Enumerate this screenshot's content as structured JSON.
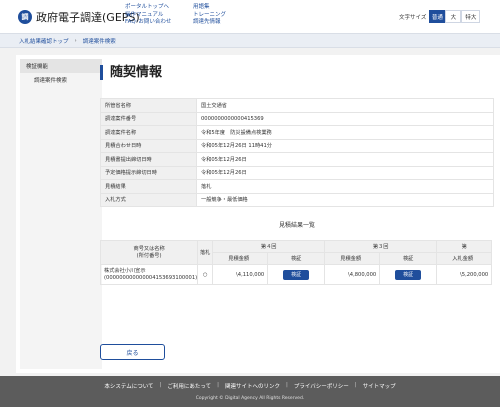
{
  "header": {
    "logo_mark": "調",
    "title": "政府電子調達(GEPS)",
    "links_col1": [
      "ポータルトップへ",
      "操作マニュアル",
      "FAQ･お問い合わせ"
    ],
    "links_col2": [
      "用語集",
      "トレーニング",
      "調達先情報"
    ],
    "fontsize_label": "文字サイズ",
    "fontsize_options": [
      "普通",
      "大",
      "特大"
    ],
    "fontsize_selected": "普通"
  },
  "breadcrumb": [
    "入札結果確認トップ",
    "調達案件検索"
  ],
  "sidebar": {
    "heading": "検証機能",
    "items": [
      "調達案件検索"
    ]
  },
  "page_title": "随契情報",
  "info": [
    {
      "label": "所管省名称",
      "value": "国土交通省"
    },
    {
      "label": "調達案件番号",
      "value": "0000000000000415369"
    },
    {
      "label": "調達案件名称",
      "value": "令和5年度　防災設備点検業務"
    },
    {
      "label": "見積合わせ日時",
      "value": "令和05年12月26日 11時41分"
    },
    {
      "label": "見積書提出締切日時",
      "value": "令和05年12月26日"
    },
    {
      "label": "予定価格提示締切日時",
      "value": "令和05年12月26日"
    },
    {
      "label": "見積結果",
      "value": "落札"
    },
    {
      "label": "入札方式",
      "value": "一般競争・最低価格"
    }
  ],
  "results": {
    "title": "見積結果一覧",
    "col_name": "商号又は名称\n(所付番号)",
    "col_rakusatsu": "落札",
    "rounds": [
      "第４回",
      "第３回",
      "第"
    ],
    "col_amount": "見積金額",
    "col_amount_last": "入札金額",
    "col_ref": "検証",
    "rows": [
      {
        "name": "株式会社小川宣示",
        "code": "(000000000000004153693100001)",
        "rakusatsu": "○",
        "r4_amount": "\\4,110,000",
        "r4_ref": "検証",
        "r3_amount": "\\4,800,000",
        "r3_ref": "検証",
        "r2_amount": "\\5,200,000"
      }
    ]
  },
  "back_label": "戻る",
  "footer": {
    "links": [
      "本システムについて",
      "ご利用にあたって",
      "関連サイトへのリンク",
      "プライバシーポリシー",
      "サイトマップ"
    ],
    "copyright": "Copyright © Digital Agency All Rights Reserved."
  },
  "colors": {
    "accent": "#1f4e9c",
    "footer_bg": "#5c5c5c",
    "page_bg": "#f2f2f2"
  }
}
